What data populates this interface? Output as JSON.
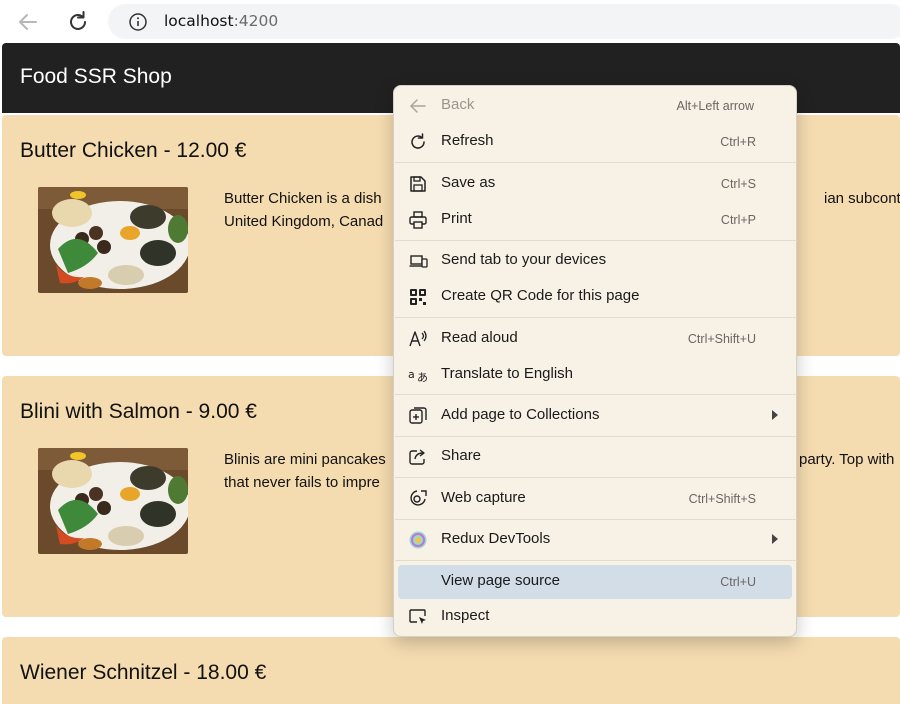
{
  "browser": {
    "address": {
      "host": "localhost",
      "port": ":4200"
    }
  },
  "app": {
    "title": "Food SSR Shop"
  },
  "products": [
    {
      "title": "Butter Chicken - 12.00 €",
      "desc_line1": "Butter Chicken is a dish",
      "desc_line2": "United Kingdom, Canad",
      "desc_tail": "ian subcontine"
    },
    {
      "title": "Blini with Salmon - 9.00 €",
      "desc_line1": "Blinis are mini pancakes",
      "desc_line2": "that never fails to impre",
      "desc_tail": "party. Top with"
    },
    {
      "title": "Wiener Schnitzel - 18.00 €"
    }
  ],
  "context_menu": {
    "items": [
      {
        "label": "Back",
        "shortcut": "Alt+Left arrow",
        "icon": "back-arrow-icon",
        "disabled": true
      },
      {
        "label": "Refresh",
        "shortcut": "Ctrl+R",
        "icon": "refresh-icon"
      },
      {
        "label": "Save as",
        "shortcut": "Ctrl+S",
        "icon": "save-icon"
      },
      {
        "label": "Print",
        "shortcut": "Ctrl+P",
        "icon": "printer-icon"
      },
      {
        "label": "Send tab to your devices",
        "shortcut": "",
        "icon": "devices-icon"
      },
      {
        "label": "Create QR Code for this page",
        "shortcut": "",
        "icon": "qr-code-icon"
      },
      {
        "label": "Read aloud",
        "shortcut": "Ctrl+Shift+U",
        "icon": "read-aloud-icon"
      },
      {
        "label": "Translate to English",
        "shortcut": "",
        "icon": "translate-icon"
      },
      {
        "label": "Add page to Collections",
        "shortcut": "",
        "icon": "collections-icon",
        "submenu": true
      },
      {
        "label": "Share",
        "shortcut": "",
        "icon": "share-icon"
      },
      {
        "label": "Web capture",
        "shortcut": "Ctrl+Shift+S",
        "icon": "web-capture-icon"
      },
      {
        "label": "Redux DevTools",
        "shortcut": "",
        "icon": "redux-devtools-icon",
        "submenu": true
      },
      {
        "label": "View page source",
        "shortcut": "Ctrl+U",
        "icon": "",
        "highlighted": true
      },
      {
        "label": "Inspect",
        "shortcut": "",
        "icon": "inspect-icon"
      }
    ]
  },
  "colors": {
    "header": "#212121",
    "card": "#f5dcb0",
    "menu_bg": "#f8f1e6",
    "menu_highlight": "#d3dde8"
  }
}
